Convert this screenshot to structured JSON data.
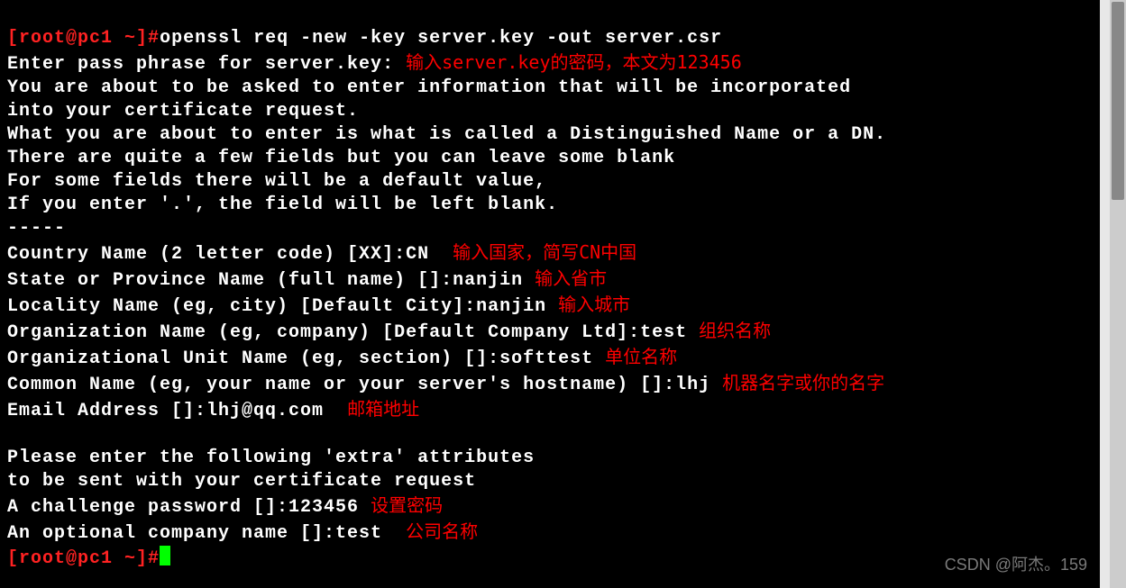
{
  "prompt": {
    "open": "[",
    "host": "root@pc1 ~",
    "close": "]#"
  },
  "command": "openssl req -new -key server.key -out server.csr",
  "lines": {
    "l1": "Enter pass phrase for server.key:",
    "l2": "You are about to be asked to enter information that will be incorporated",
    "l3": "into your certificate request.",
    "l4": "What you are about to enter is what is called a Distinguished Name or a DN.",
    "l5": "There are quite a few fields but you can leave some blank",
    "l6": "For some fields there will be a default value,",
    "l7": "If you enter '.', the field will be left blank.",
    "l8": "-----",
    "l9": "Country Name (2 letter code) [XX]:CN",
    "l10": "State or Province Name (full name) []:nanjin",
    "l11": "Locality Name (eg, city) [Default City]:nanjin",
    "l12": "Organization Name (eg, company) [Default Company Ltd]:test",
    "l13": "Organizational Unit Name (eg, section) []:softtest",
    "l14": "Common Name (eg, your name or your server's hostname) []:lhj",
    "l15": "Email Address []:lhj@qq.com",
    "l16": "",
    "l17": "Please enter the following 'extra' attributes",
    "l18": "to be sent with your certificate request",
    "l19": "A challenge password []:123456",
    "l20": "An optional company name []:test"
  },
  "annotations": {
    "a1": "输入server.key的密码，本文为123456",
    "a9": "输入国家，简写CN中国",
    "a10": "输入省市",
    "a11": "输入城市",
    "a12": "组织名称",
    "a13": "单位名称",
    "a14": "机器名字或你的名字",
    "a15": "邮箱地址",
    "a19": "设置密码",
    "a20": "公司名称"
  },
  "watermark": "CSDN @阿杰。159"
}
